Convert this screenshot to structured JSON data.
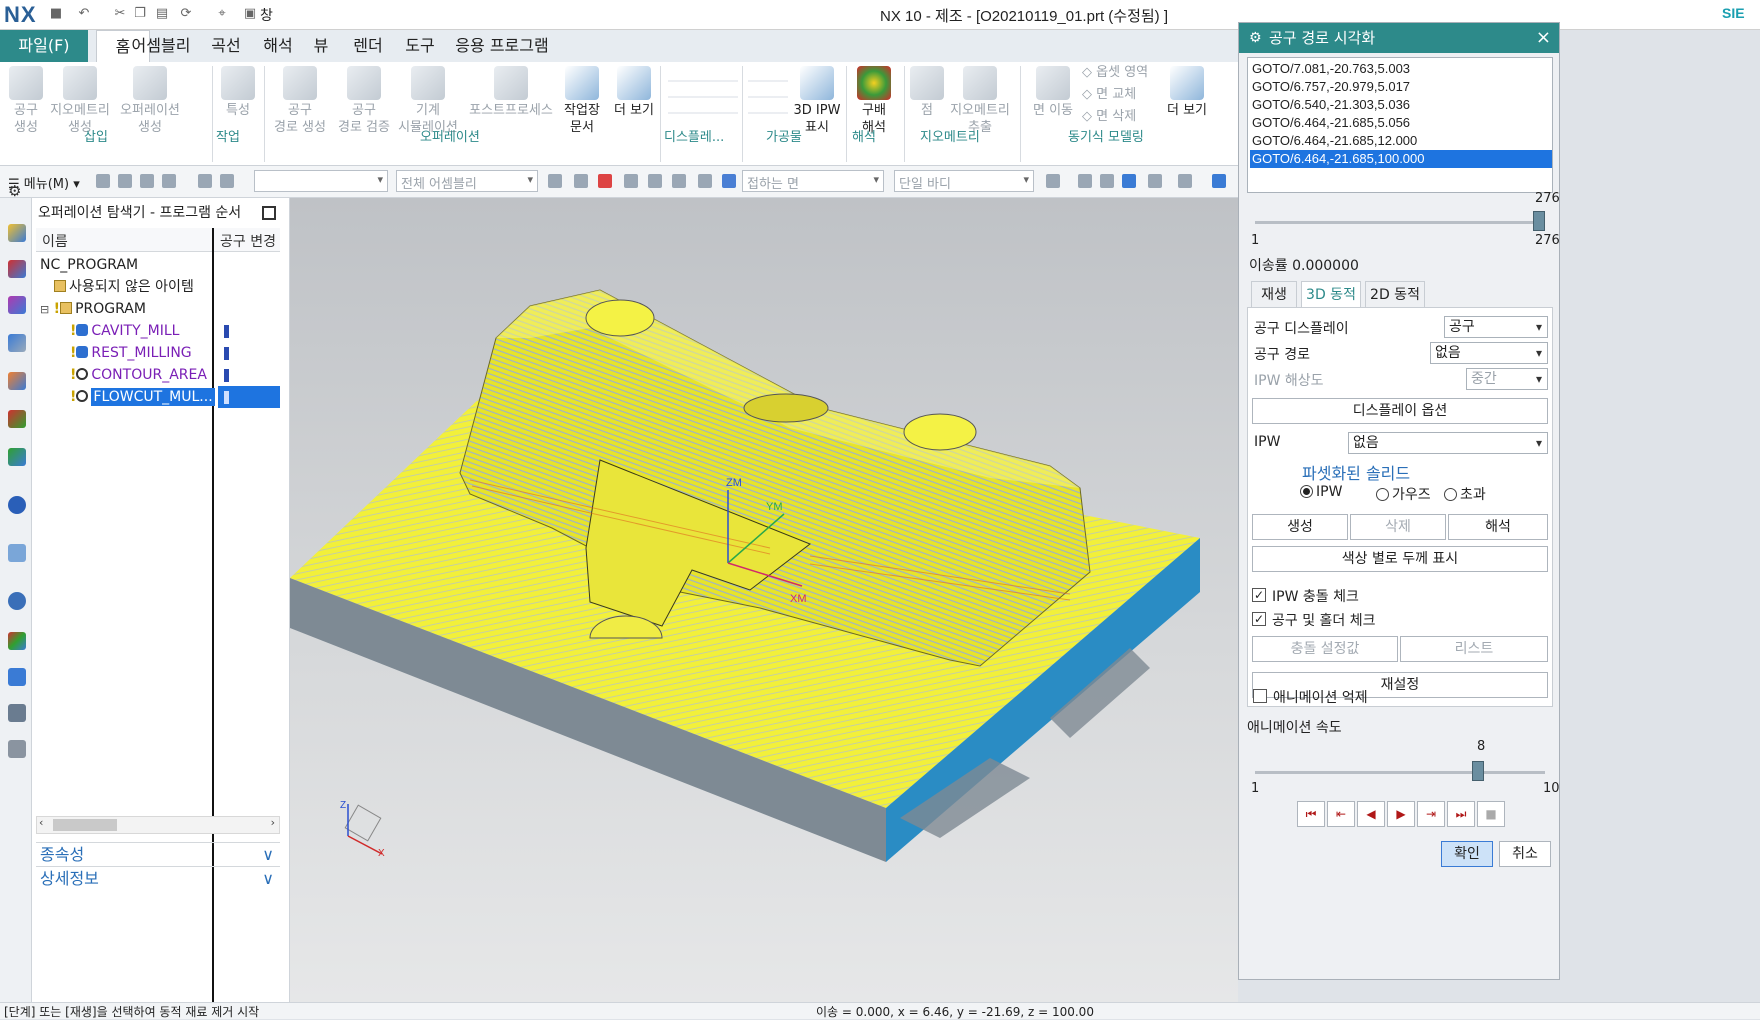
{
  "app": {
    "title": "NX 10 - 제조 - [O20210119_01.prt (수정됨) ]",
    "logo": "NX",
    "brand": "SIE",
    "window_menu": "창"
  },
  "ribbon": {
    "tabs": [
      "파일(F)",
      "홈",
      "어셈블리",
      "곡선",
      "해석",
      "뷰",
      "렌더",
      "도구",
      "응용 프로그램"
    ],
    "buttons": [
      {
        "label1": "공구",
        "label2": "생성"
      },
      {
        "label1": "지오메트리",
        "label2": "생성"
      },
      {
        "label1": "오퍼레이션",
        "label2": "생성"
      },
      {
        "label1": "특성",
        "label2": ""
      },
      {
        "label1": "공구",
        "label2": "경로 생성"
      },
      {
        "label1": "공구",
        "label2": "경로 검증"
      },
      {
        "label1": "기계",
        "label2": "시뮬레이션"
      },
      {
        "label1": "포스트프로세스",
        "label2": ""
      },
      {
        "label1": "작업장",
        "label2": "문서"
      },
      {
        "label1": "더 보기",
        "label2": ""
      },
      {
        "label1": "3D IPW",
        "label2": "표시"
      },
      {
        "label1": "구배",
        "label2": "해석"
      },
      {
        "label1": "점",
        "label2": ""
      },
      {
        "label1": "지오메트리",
        "label2": "추출"
      },
      {
        "label1": "면 이동",
        "label2": ""
      },
      {
        "label1": "더 보기",
        "label2": ""
      }
    ],
    "side_items": [
      "옵셋 영역",
      "면 교체",
      "면 삭제"
    ],
    "groups": [
      "삽입",
      "작업",
      "오퍼레이션",
      "디스플레...",
      "가공물",
      "해석",
      "지오메트리",
      "동기식 모델링"
    ]
  },
  "toolbar": {
    "menu_label": "메뉴(M)",
    "combo1": "",
    "assembly_filter": "전체 어셈블리",
    "face_rule": "접하는 면",
    "body_rule": "단일 바디"
  },
  "navigator": {
    "title": "오퍼레이션 탐색기 - 프로그램 순서",
    "col_name": "이름",
    "col_toolchange": "공구 변경",
    "rows": [
      {
        "label": "NC_PROGRAM",
        "indent": 0
      },
      {
        "label": "사용되지 않은 아이템",
        "indent": 1
      },
      {
        "label": "PROGRAM",
        "indent": 1
      },
      {
        "label": "CAVITY_MILL",
        "indent": 2
      },
      {
        "label": "REST_MILLING",
        "indent": 2
      },
      {
        "label": "CONTOUR_AREA",
        "indent": 2
      },
      {
        "label": "FLOWCUT_MUL...",
        "indent": 2
      }
    ],
    "footer1": "종속성",
    "footer2": "상세정보"
  },
  "viewport": {
    "axis_zm": "ZM",
    "axis_ym": "YM",
    "axis_xm": "XM",
    "triad_z": "Z",
    "triad_x": "X"
  },
  "dialog": {
    "title": "공구 경로 시각화",
    "goto_lines": [
      "GOTO/7.081,-20.763,5.003",
      "GOTO/6.757,-20.979,5.017",
      "GOTO/6.540,-21.303,5.036",
      "GOTO/6.464,-21.685,5.056",
      "GOTO/6.464,-21.685,12.000",
      "GOTO/6.464,-21.685,100.000"
    ],
    "selected_goto": 5,
    "slider": {
      "value": "276",
      "min": "1",
      "max": "276",
      "fraction": 1.0
    },
    "feed_rate": "이송률 0.000000",
    "tabs": [
      "재생",
      "3D 동적",
      "2D 동적"
    ],
    "active_tab": 1,
    "tool_display_label": "공구 디스플레이",
    "tool_display_value": "공구",
    "toolpath_label": "공구 경로",
    "toolpath_value": "없음",
    "ipw_res_label": "IPW 해상도",
    "ipw_res_value": "중간",
    "display_options_btn": "디스플레이 옵션",
    "ipw_label": "IPW",
    "ipw_value": "없음",
    "faceted_solid_label": "파셋화된 솔리드",
    "radio_ipw": "IPW",
    "radio_gouge": "가우즈",
    "radio_excess": "초과",
    "btn_create": "생성",
    "btn_delete": "삭제",
    "btn_analyze": "해석",
    "btn_color_thickness": "색상 별로 두께 표시",
    "chk_ipw_collision": "IPW 충돌 체크",
    "chk_tool_holder": "공구 및 홀더 체크",
    "btn_collision_settings": "충돌 설정값",
    "btn_list": "리스트",
    "btn_reset": "재설정",
    "chk_suppress_anim": "애니메이션 억제",
    "anim_speed_label": "애니메이션 속도",
    "anim_speed": {
      "value": "8",
      "min": "1",
      "max": "10",
      "fraction": 0.78
    },
    "btn_ok": "확인",
    "btn_cancel": "취소"
  },
  "status": {
    "left": "[단계] 또는 [재생]을 선택하여 동적 재료 제거 시작",
    "right": "이송 = 0.000, x = 6.46, y = -21.69, z = 100.00"
  },
  "colors": {
    "accent": "#2d8a8a",
    "stock": "#f0ee32",
    "stock_side": "#2a8cc4",
    "selection": "#1e74e0"
  }
}
